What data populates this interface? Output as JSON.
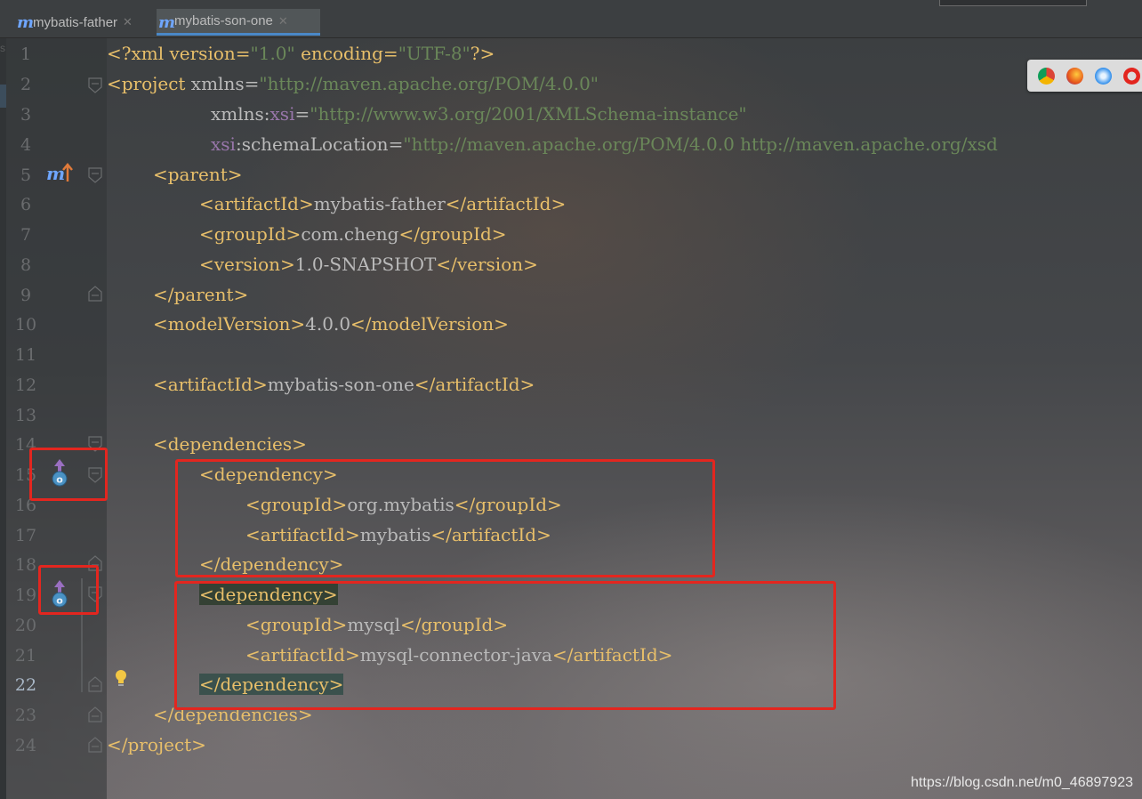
{
  "tabs": [
    {
      "label": "mybatis-father",
      "icon": "maven-icon",
      "active": false
    },
    {
      "label": "mybatis-son-one",
      "icon": "maven-icon",
      "active": true
    }
  ],
  "sidebar_letter": "s",
  "line_numbers": [
    "1",
    "2",
    "3",
    "4",
    "5",
    "6",
    "7",
    "8",
    "9",
    "10",
    "11",
    "12",
    "13",
    "14",
    "15",
    "16",
    "17",
    "18",
    "19",
    "20",
    "21",
    "22",
    "23",
    "24"
  ],
  "current_line": "22",
  "code": {
    "l1": {
      "p1": "<?xml version=",
      "v1": "\"1.0\"",
      "p2": " encoding=",
      "v2": "\"UTF-8\"",
      "p3": "?>"
    },
    "l2": {
      "t": "<project ",
      "a": "xmlns=",
      "v": "\"http://maven.apache.org/POM/4.0.0\""
    },
    "l3": {
      "a1": "xmlns:",
      "ns": "xsi",
      "a2": "=",
      "v": "\"http://www.w3.org/2001/XMLSchema-instance\""
    },
    "l4": {
      "ns": "xsi",
      "a": ":schemaLocation=",
      "v": "\"http://maven.apache.org/POM/4.0.0 http://maven.apache.org/xsd"
    },
    "l5": {
      "t": "<parent>"
    },
    "l6": {
      "o": "<artifactId>",
      "x": "mybatis-father",
      "c": "</artifactId>"
    },
    "l7": {
      "o": "<groupId>",
      "x": "com.cheng",
      "c": "</groupId>"
    },
    "l8": {
      "o": "<version>",
      "x": "1.0-SNAPSHOT",
      "c": "</version>"
    },
    "l9": {
      "t": "</parent>"
    },
    "l10": {
      "o": "<modelVersion>",
      "x": "4.0.0",
      "c": "</modelVersion>"
    },
    "l12": {
      "o": "<artifactId>",
      "x": "mybatis-son-one",
      "c": "</artifactId>"
    },
    "l14": {
      "t": "<dependencies>"
    },
    "l15": {
      "t": "<dependency>"
    },
    "l16": {
      "o": "<groupId>",
      "x": "org.mybatis",
      "c": "</groupId>"
    },
    "l17": {
      "o": "<artifactId>",
      "x": "mybatis",
      "c": "</artifactId>"
    },
    "l18": {
      "t": "</dependency>"
    },
    "l19": {
      "t": "<dependency>"
    },
    "l20": {
      "o": "<groupId>",
      "x": "mysql",
      "c": "</groupId>"
    },
    "l21": {
      "o": "<artifactId>",
      "x": "mysql-connector-java",
      "c": "</artifactId>"
    },
    "l22": {
      "t": "</dependency>"
    },
    "l23": {
      "t": "</dependencies>"
    },
    "l24": {
      "t": "</project>"
    }
  },
  "browsers": [
    "chrome-icon",
    "firefox-icon",
    "safari-icon",
    "opera-icon"
  ],
  "watermark": "https://blog.csdn.net/m0_46897923",
  "colors": {
    "tag": "#e8bf6a",
    "text": "#bababa",
    "attr_value": "#6a8759",
    "namespace": "#9876aa",
    "highlight_box": "#e3261f",
    "active_tab_underline": "#4a88c7"
  }
}
